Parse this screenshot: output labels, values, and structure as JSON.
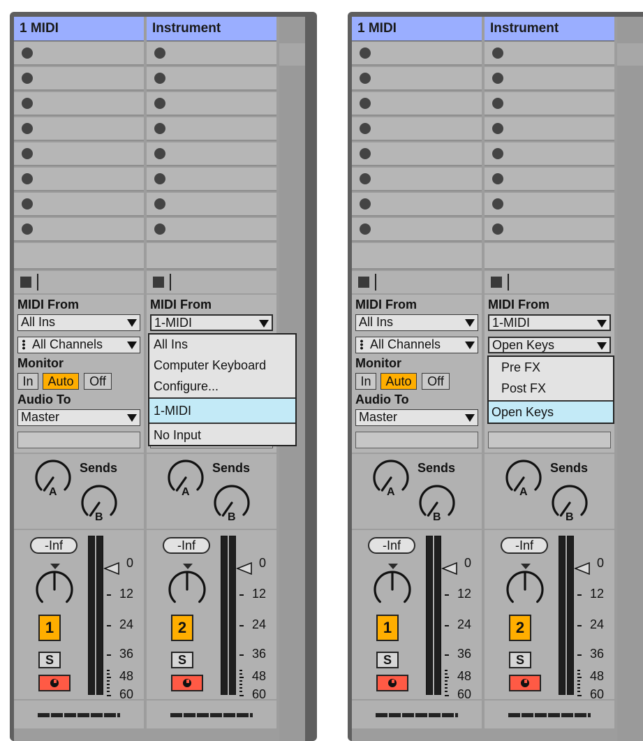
{
  "panels": [
    {
      "tracks": [
        {
          "name": "1 MIDI",
          "midi_from_label": "MIDI From",
          "input": "All Ins",
          "channel": "All Channels",
          "monitor_label": "Monitor",
          "monitor": [
            "In",
            "Auto",
            "Off"
          ],
          "audio_to_label": "Audio To",
          "audio_to": "Master",
          "sends_label": "Sends",
          "send_a": "A",
          "send_b": "B",
          "volume": "-Inf",
          "number": "1",
          "solo": "S"
        },
        {
          "name": "Instrument",
          "midi_from_label": "MIDI From",
          "input": "1-MIDI",
          "sends_label": "Sends",
          "send_a": "A",
          "send_b": "B",
          "volume": "-Inf",
          "number": "2",
          "solo": "S"
        }
      ],
      "menu": {
        "items": [
          "All Ins",
          "Computer Keyboard",
          "Configure...",
          "1-MIDI",
          "No Input"
        ],
        "selected": "1-MIDI"
      }
    },
    {
      "tracks": [
        {
          "name": "1 MIDI",
          "midi_from_label": "MIDI From",
          "input": "All Ins",
          "channel": "All Channels",
          "monitor_label": "Monitor",
          "monitor": [
            "In",
            "Auto",
            "Off"
          ],
          "audio_to_label": "Audio To",
          "audio_to": "Master",
          "sends_label": "Sends",
          "send_a": "A",
          "send_b": "B",
          "volume": "-Inf",
          "number": "1",
          "solo": "S"
        },
        {
          "name": "Instrument",
          "midi_from_label": "MIDI From",
          "input": "1-MIDI",
          "channel": "Open Keys",
          "sends_label": "Sends",
          "send_a": "A",
          "send_b": "B",
          "volume": "-Inf",
          "number": "2",
          "solo": "S"
        }
      ],
      "menu": {
        "items": [
          "Pre FX",
          "Post FX",
          "Open Keys"
        ],
        "selected": "Open Keys"
      }
    }
  ],
  "meter_scale": [
    "0",
    "12",
    "24",
    "36",
    "48",
    "60"
  ],
  "colors": {
    "header": "#9aaeff",
    "active": "#ffae00",
    "arm": "#ff5a45",
    "menu_selected": "#c3eaf7"
  },
  "icons": {
    "clip_slot": "circle-icon",
    "stop": "stop-icon",
    "send_knob": "knob-icon",
    "pan": "pan-knob-icon",
    "arm": "record-arm-icon",
    "peak": "triangle-left-icon"
  }
}
